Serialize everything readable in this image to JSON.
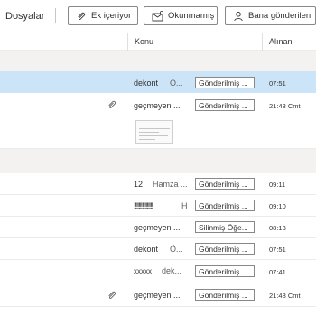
{
  "toolbar": {
    "title": "Dosyalar",
    "filters": [
      {
        "label": "Ek içeriyor",
        "icon": "paperclip-icon"
      },
      {
        "label": "Okunmamış",
        "icon": "envelope-icon"
      },
      {
        "label": "Bana gönderilen",
        "icon": "person-icon"
      }
    ]
  },
  "columns": {
    "subject": "Konu",
    "received": "Alınan"
  },
  "rows": [
    {
      "from": "dekont",
      "preview": "Ö...",
      "folder": "Gönderilmiş ...",
      "time": "07:51",
      "selected": true,
      "attachment": false
    },
    {
      "from": "geçmeyen ...",
      "preview": "",
      "folder": "Gönderilmiş ...",
      "time": "21:48 Cmt",
      "selected": false,
      "attachment": true
    },
    {
      "from": "12",
      "preview": "Hamza ...",
      "folder": "Gönderilmiş ...",
      "time": "09:11",
      "selected": false,
      "attachment": false
    },
    {
      "from": "!!!!!!!!!!!!!!!!",
      "preview": "H",
      "folder": "Gönderilmiş ...",
      "time": "09:10",
      "selected": false,
      "attachment": false
    },
    {
      "from": "geçmeyen ...",
      "preview": "",
      "folder": "Silinmiş Öğe...",
      "time": "08:13",
      "selected": false,
      "attachment": false
    },
    {
      "from": "dekont",
      "preview": "Ö...",
      "folder": "Gönderilmiş ...",
      "time": "07:51",
      "selected": false,
      "attachment": false
    },
    {
      "from": "xxxxx",
      "preview": "dek...",
      "folder": "Gönderilmiş ...",
      "time": "07:41",
      "selected": false,
      "attachment": false
    },
    {
      "from": "geçmeyen ...",
      "preview": "",
      "folder": "Gönderilmiş ...",
      "time": "21:48 Cmt",
      "selected": false,
      "attachment": true
    }
  ]
}
